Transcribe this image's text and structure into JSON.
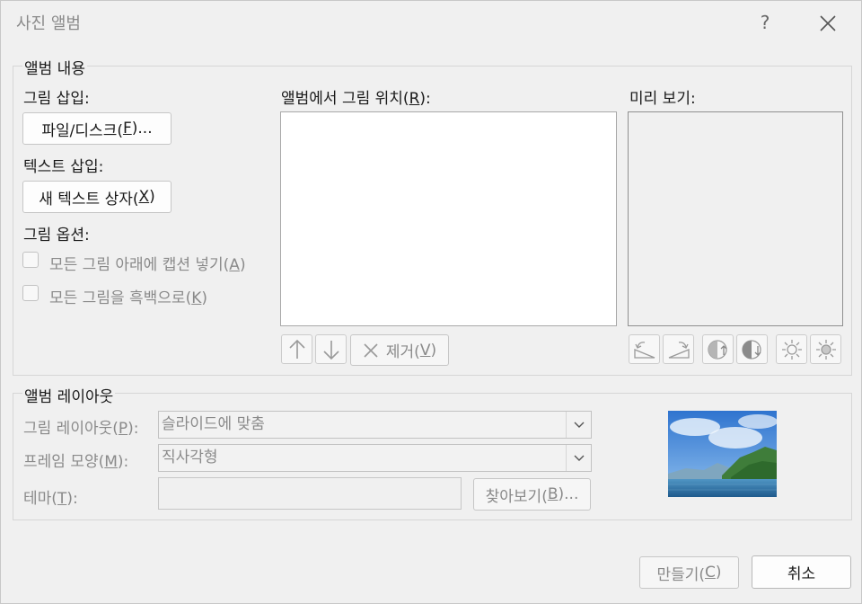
{
  "window": {
    "title": "사진 앨범",
    "help_glyph": "?",
    "close_glyph": "✕"
  },
  "album_content": {
    "legend": "앨범 내용",
    "insert_picture_label": "그림 삽입:",
    "file_disk_button": {
      "text": "파일/디스크(",
      "key": "F",
      "suffix": ")..."
    },
    "insert_text_label": "텍스트 삽입:",
    "new_textbox_button": {
      "text": "새 텍스트 상자(",
      "key": "X",
      "suffix": ")"
    },
    "picture_options_label": "그림 옵션:",
    "captions_checkbox": {
      "text": "모든 그림 아래에 캡션 넣기(",
      "key": "A",
      "suffix": ")",
      "checked": false
    },
    "bw_checkbox": {
      "text": "모든 그림을 흑백으로(",
      "key": "K",
      "suffix": ")",
      "checked": false
    },
    "pictures_in_album_label": {
      "text": "앨범에서 그림 위치(",
      "key": "R",
      "suffix": "):"
    },
    "remove_button": {
      "text": "제거(",
      "key": "V",
      "suffix": ")"
    },
    "preview_label": "미리 보기:"
  },
  "album_layout": {
    "legend": "앨범 레이아웃",
    "picture_layout_label": {
      "text": "그림 레이아웃(",
      "key": "P",
      "suffix": "):"
    },
    "picture_layout_value": "슬라이드에 맞춤",
    "frame_shape_label": {
      "text": "프레임 모양(",
      "key": "M",
      "suffix": "):"
    },
    "frame_shape_value": "직사각형",
    "theme_label": {
      "text": "테마(",
      "key": "T",
      "suffix": "):"
    },
    "theme_value": "",
    "browse_button": {
      "text": "찾아보기(",
      "key": "B",
      "suffix": ")..."
    }
  },
  "footer": {
    "create_button": {
      "text": "만들기(",
      "key": "C",
      "suffix": ")"
    },
    "cancel_button": "취소"
  },
  "colors": {
    "sky": "#3e86d8",
    "water": "#2f6fa6",
    "hills": "#3f7d3a",
    "disabled_text": "#8a8a8a"
  }
}
